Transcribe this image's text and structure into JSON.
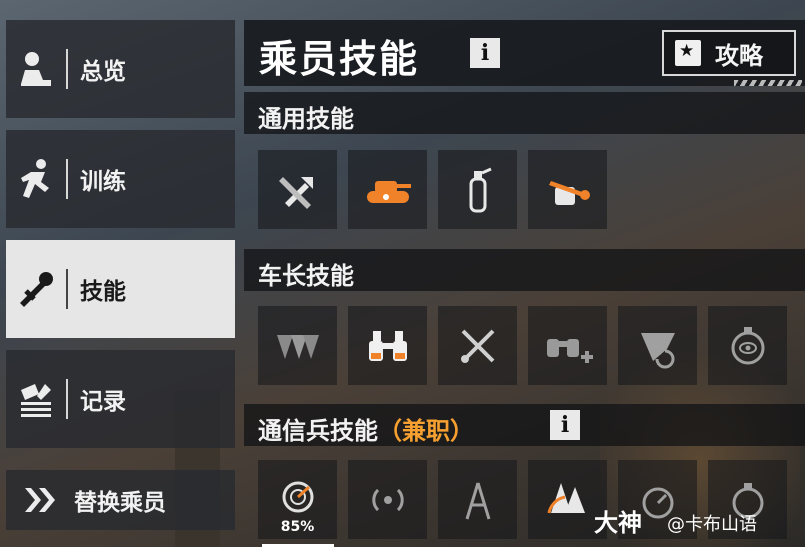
{
  "sidebar": {
    "items": [
      {
        "label": "总览",
        "icon": "overview-person-icon"
      },
      {
        "label": "训练",
        "icon": "running-man-icon"
      },
      {
        "label": "技能",
        "icon": "wrench-skill-icon",
        "active": true
      },
      {
        "label": "记录",
        "icon": "record-book-icon"
      }
    ],
    "replace_crew": {
      "label": "替换乘员",
      "icon": "double-chevron-right-icon"
    }
  },
  "header": {
    "title": "乘员技能",
    "info_icon": "i",
    "guide_button": "攻略"
  },
  "sections": {
    "general": {
      "title": "通用技能",
      "skills": [
        "tools-icon",
        "tank-eye-icon",
        "fire-extinguisher-icon",
        "fist-wrench-icon"
      ]
    },
    "commander": {
      "title": "车长技能",
      "skills": [
        "triangles-icon",
        "binoculars-icon",
        "crossed-tools-icon",
        "binoculars-plus-icon",
        "radar-sweep-icon",
        "stopwatch-eye-icon"
      ]
    },
    "radio": {
      "title": "通信兵技能",
      "subtitle": "（兼职）",
      "info_icon": "i",
      "skills": [
        "radar-icon",
        "signal-waves-icon",
        "radio-tower-icon",
        "signal-trees-icon",
        "timer-icon",
        "stopwatch-icon"
      ],
      "progress_label": "85%",
      "progress": 0.85
    }
  },
  "watermark": {
    "brand": "大神",
    "user": "@卡布山语"
  },
  "colors": {
    "accent_orange": "#f0822a",
    "active_tab": "#e6e6e6"
  }
}
